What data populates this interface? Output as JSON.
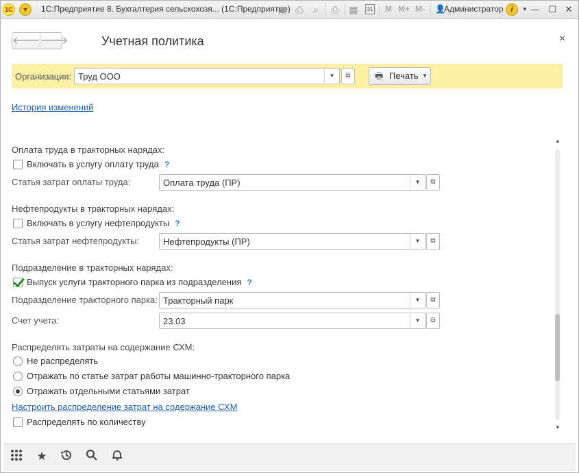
{
  "window": {
    "app_title": "1С:Предприятие 8. Бухгалтерия сельскохозя... (1С:Предприятие)",
    "logo_text": "1С",
    "m_labels": [
      "M",
      "M+",
      "M-"
    ],
    "user_name": "Администратор",
    "calendar_day": "31",
    "icons": [
      "1c-logo-icon",
      "main-menu-icon",
      "save-icon",
      "print-icon",
      "preview-icon",
      "print-alt-icon",
      "calculator-icon",
      "calendar-icon",
      "user-icon",
      "info-icon",
      "minimize-icon",
      "maximize-icon",
      "close-icon"
    ]
  },
  "form": {
    "title": "Учетная политика",
    "close_symbol": "×",
    "nav_back": "🡐",
    "nav_forward": "🡒"
  },
  "org": {
    "label": "Организация:",
    "value": "Труд ООО",
    "print_label": "Печать"
  },
  "history_link": "История изменений",
  "labor": {
    "title": "Оплата труда в тракторных нарядах:",
    "include_label": "Включать в услугу оплату труда",
    "include_checked": false,
    "cost_label": "Статья затрат оплаты труда:",
    "cost_value": "Оплата труда (ПР)"
  },
  "fuel": {
    "title": "Нефтепродукты в тракторных нарядах:",
    "include_label": "Включать в услугу нефтепродукты",
    "include_checked": false,
    "cost_label": "Статья затрат нефтепродукты:",
    "cost_value": "Нефтепродукты (ПР)"
  },
  "division": {
    "title": "Подразделение в тракторных нарядах:",
    "release_label": "Выпуск услуги тракторного парка из подразделения",
    "release_checked": true,
    "park_label": "Подразделение тракторного парка:",
    "park_value": "Тракторный парк",
    "account_label": "Счет учета:",
    "account_value": "23.03"
  },
  "distribution": {
    "title": "Распределять затраты на содержание СХМ:",
    "options": [
      {
        "label": "Не распределять",
        "selected": false
      },
      {
        "label": "Отражать по статье затрат работы машинно-тракторного парка",
        "selected": false
      },
      {
        "label": "Отражать отдельными статьями затрат",
        "selected": true
      }
    ],
    "setup_link": "Настроить распределение затрат на содержание СХМ",
    "by_quantity_label": "Распределять по количеству",
    "by_quantity_checked": false
  },
  "help_symbol": "?",
  "bottom_bar": {
    "icons": [
      "apps-grid-icon",
      "favorites-star-icon",
      "history-icon",
      "search-icon",
      "notifications-bell-icon"
    ]
  },
  "colors": {
    "org_bar_bg": "#fbf0a4",
    "link": "#1f5fa9",
    "help": "#1f7fd1",
    "check_green": "#1e8f2a"
  }
}
